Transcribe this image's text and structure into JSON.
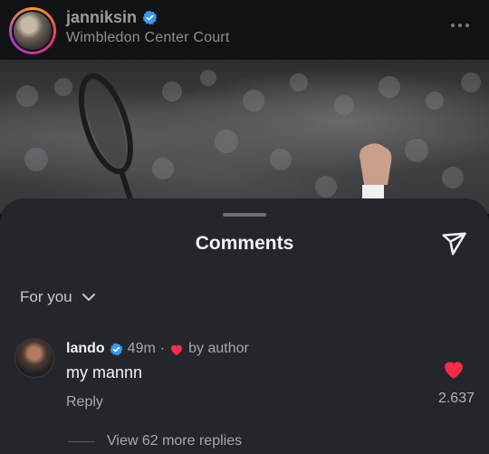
{
  "post": {
    "username": "janniksin",
    "location": "Wimbledon Center Court"
  },
  "comments_sheet": {
    "title": "Comments",
    "sort_label": "For you"
  },
  "comment": {
    "username": "lando",
    "time": "49m",
    "separator": "·",
    "liked_by": "by author",
    "text": "my mannn",
    "reply_label": "Reply",
    "like_count": "2.637",
    "view_replies": "View 62 more replies"
  },
  "colors": {
    "verified": "#3897f0",
    "heart": "#ff2a45",
    "sheet_bg": "#25262b"
  },
  "icons": [
    "verified-badge-icon",
    "more-options-icon",
    "share-icon",
    "chevron-down-icon",
    "heart-icon"
  ]
}
